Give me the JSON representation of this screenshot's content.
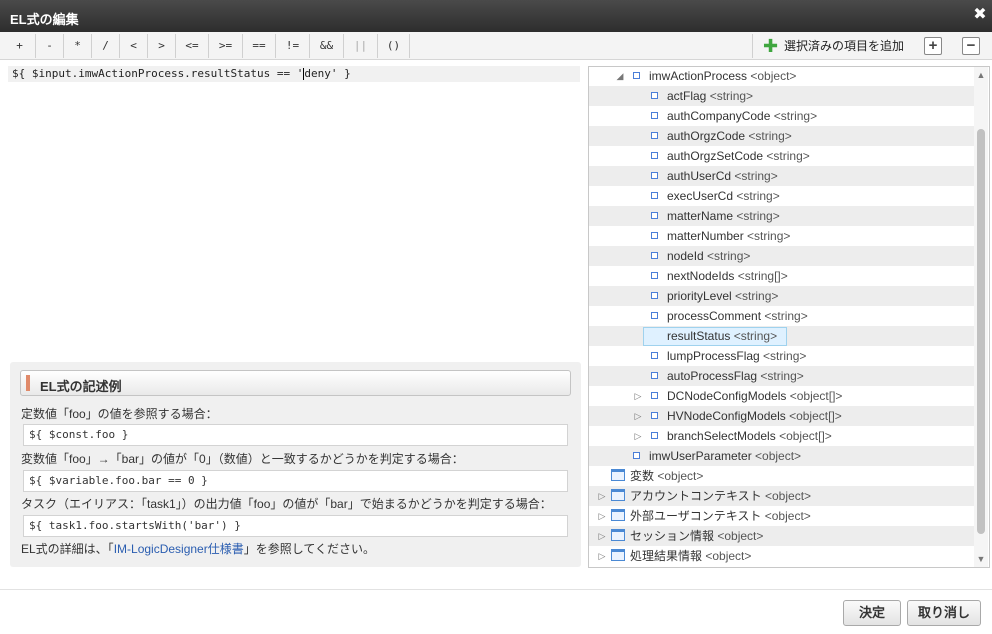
{
  "window": {
    "title": "EL式の編集",
    "close_icon": "close-icon"
  },
  "toolbar": {
    "operators": [
      "+",
      "-",
      "*",
      "/",
      "<",
      ">",
      "<=",
      ">=",
      "==",
      "!=",
      "&&",
      "||",
      "()"
    ],
    "disabled_operator": "||",
    "add_selected_label": "選択済みの項目を追加",
    "expand_icon": "plus-square-icon",
    "collapse_icon": "minus-square-icon"
  },
  "editor": {
    "before_caret": "${ $input.imwActionProcess.resultStatus == '",
    "after_caret": "deny' }"
  },
  "examples": {
    "heading": "EL式の記述例",
    "items": [
      {
        "desc": "定数値「foo」の値を参照する場合：",
        "code": "${ $const.foo }"
      },
      {
        "desc": "変数値「foo」→「bar」の値が「0」（数値）と一致するかどうかを判定する場合：",
        "code": "${ $variable.foo.bar == 0 }"
      },
      {
        "desc": "タスク（エイリアス：「task1」）の出力値「foo」の値が「bar」で始まるかどうかを判定する場合：",
        "code": "${ task1.foo.startsWith('bar') }"
      }
    ],
    "footer_before": "EL式の詳細は、「",
    "footer_link": "IM-LogicDesigner仕様書",
    "footer_after": "」を参照してください。"
  },
  "tree": {
    "selected": "resultStatus",
    "rows": [
      {
        "name": "imwActionProcess",
        "type": "<object>",
        "kind": "leaf",
        "expander": "expanded",
        "level": 1
      },
      {
        "name": "actFlag",
        "type": "<string>",
        "kind": "leaf",
        "expander": "none",
        "level": 2
      },
      {
        "name": "authCompanyCode",
        "type": "<string>",
        "kind": "leaf",
        "expander": "none",
        "level": 2
      },
      {
        "name": "authOrgzCode",
        "type": "<string>",
        "kind": "leaf",
        "expander": "none",
        "level": 2
      },
      {
        "name": "authOrgzSetCode",
        "type": "<string>",
        "kind": "leaf",
        "expander": "none",
        "level": 2
      },
      {
        "name": "authUserCd",
        "type": "<string>",
        "kind": "leaf",
        "expander": "none",
        "level": 2
      },
      {
        "name": "execUserCd",
        "type": "<string>",
        "kind": "leaf",
        "expander": "none",
        "level": 2
      },
      {
        "name": "matterName",
        "type": "<string>",
        "kind": "leaf",
        "expander": "none",
        "level": 2
      },
      {
        "name": "matterNumber",
        "type": "<string>",
        "kind": "leaf",
        "expander": "none",
        "level": 2
      },
      {
        "name": "nodeId",
        "type": "<string>",
        "kind": "leaf",
        "expander": "none",
        "level": 2
      },
      {
        "name": "nextNodeIds",
        "type": "<string[]>",
        "kind": "leaf",
        "expander": "none",
        "level": 2
      },
      {
        "name": "priorityLevel",
        "type": "<string>",
        "kind": "leaf",
        "expander": "none",
        "level": 2
      },
      {
        "name": "processComment",
        "type": "<string>",
        "kind": "leaf",
        "expander": "none",
        "level": 2
      },
      {
        "name": "resultStatus",
        "type": "<string>",
        "kind": "leaf",
        "expander": "none",
        "level": 2
      },
      {
        "name": "lumpProcessFlag",
        "type": "<string>",
        "kind": "leaf",
        "expander": "none",
        "level": 2
      },
      {
        "name": "autoProcessFlag",
        "type": "<string>",
        "kind": "leaf",
        "expander": "none",
        "level": 2
      },
      {
        "name": "DCNodeConfigModels",
        "type": "<object[]>",
        "kind": "leaf",
        "expander": "collapsed",
        "level": 2
      },
      {
        "name": "HVNodeConfigModels",
        "type": "<object[]>",
        "kind": "leaf",
        "expander": "collapsed",
        "level": 2
      },
      {
        "name": "branchSelectModels",
        "type": "<object[]>",
        "kind": "leaf",
        "expander": "collapsed",
        "level": 2
      },
      {
        "name": "imwUserParameter",
        "type": "<object>",
        "kind": "leaf",
        "expander": "none",
        "level": 1
      },
      {
        "name": "変数",
        "type": "<object>",
        "kind": "folder",
        "expander": "none",
        "level": 0
      },
      {
        "name": "アカウントコンテキスト",
        "type": "<object>",
        "kind": "folder",
        "expander": "collapsed",
        "level": 0
      },
      {
        "name": "外部ユーザコンテキスト",
        "type": "<object>",
        "kind": "folder",
        "expander": "collapsed",
        "level": 0
      },
      {
        "name": "セッション情報",
        "type": "<object>",
        "kind": "folder",
        "expander": "collapsed",
        "level": 0
      },
      {
        "name": "処理結果情報",
        "type": "<object>",
        "kind": "folder",
        "expander": "collapsed",
        "level": 0
      }
    ]
  },
  "footer": {
    "ok_label": "決定",
    "cancel_label": "取り消し"
  }
}
